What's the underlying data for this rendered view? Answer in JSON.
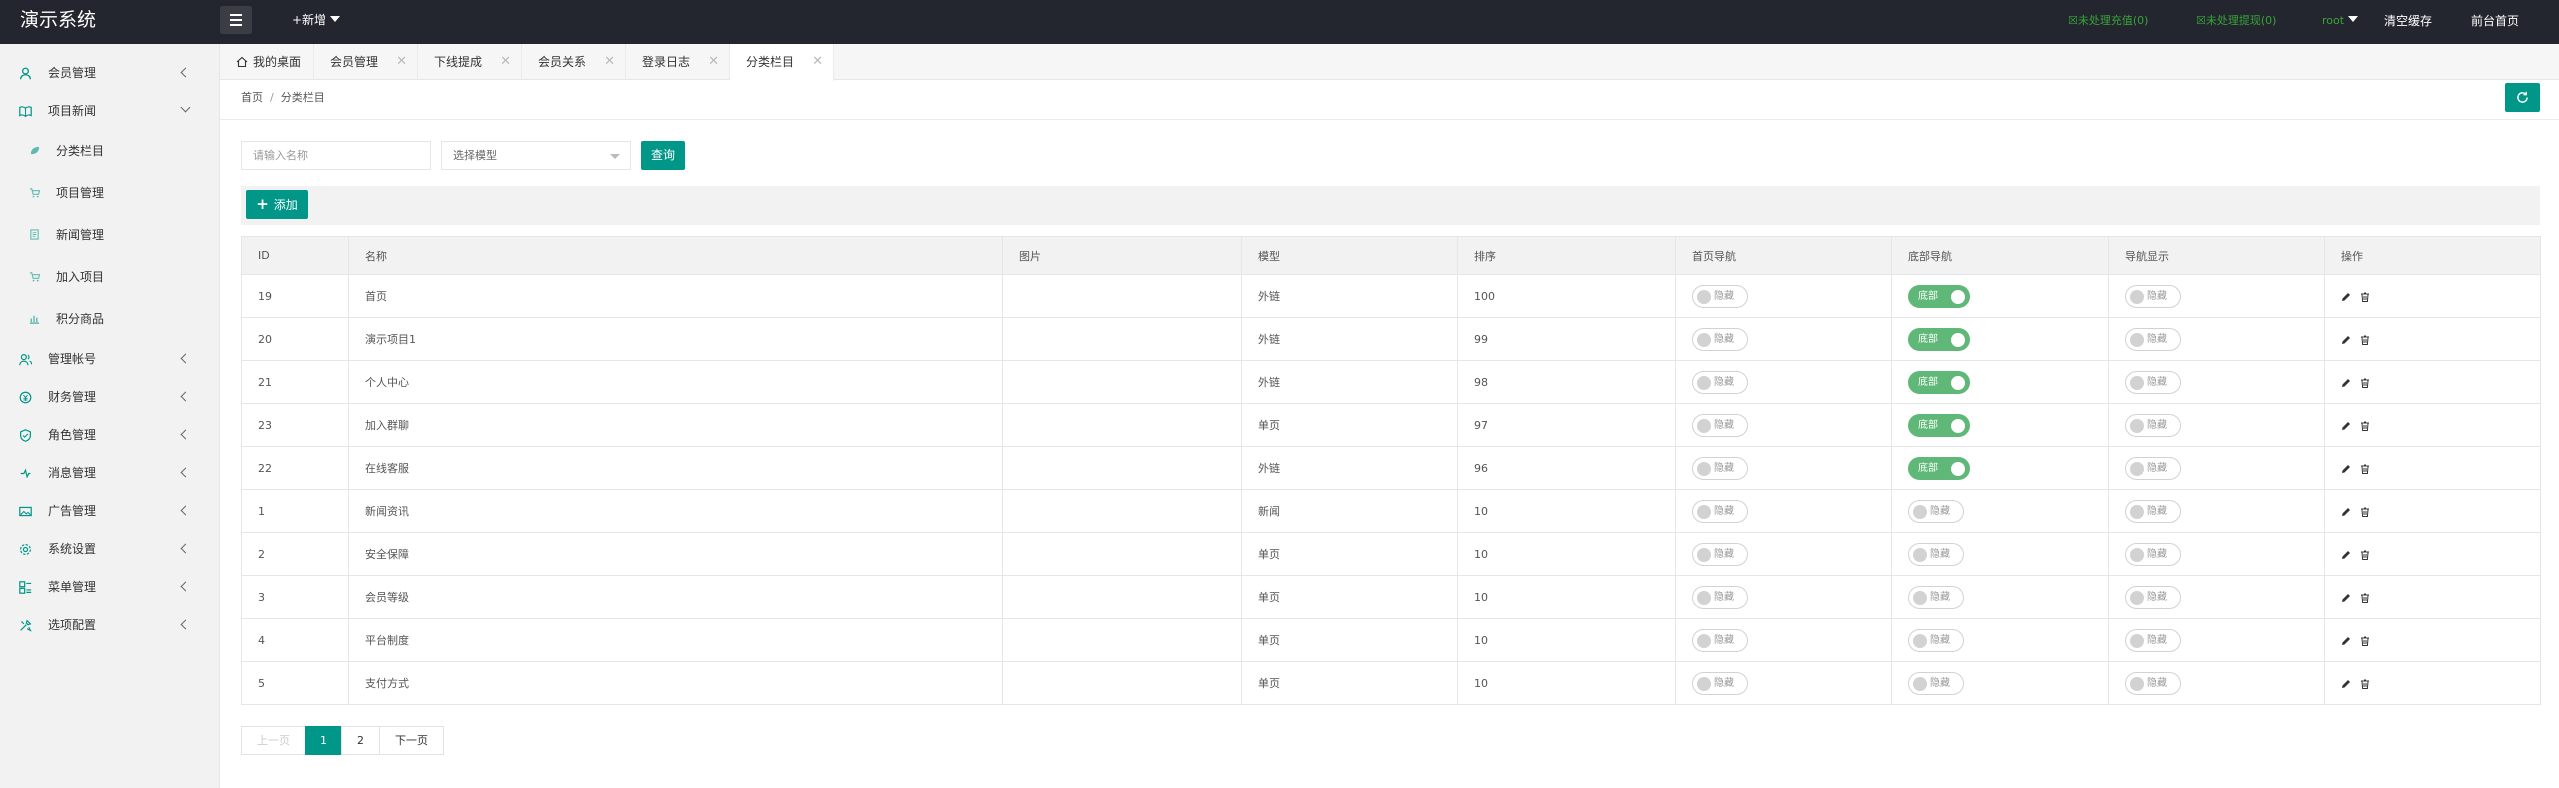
{
  "header": {
    "logo": "演示系统",
    "add_new": "+新增",
    "pending_recharge": "未处理充值(0)",
    "pending_withdraw": "未处理提现(0)",
    "user": "root",
    "clear_cache": "清空缓存",
    "frontend_home": "前台首页",
    "accent_color": "#3aa33a"
  },
  "sidebar": {
    "items": [
      {
        "label": "会员管理",
        "icon": "user-icon"
      },
      {
        "label": "项目新闻",
        "icon": "book-icon",
        "expanded": true,
        "children": [
          {
            "label": "分类栏目",
            "icon": "leaf-icon"
          },
          {
            "label": "项目管理",
            "icon": "cart-icon"
          },
          {
            "label": "新闻管理",
            "icon": "doc-icon"
          },
          {
            "label": "加入项目",
            "icon": "cart-icon"
          },
          {
            "label": "积分商品",
            "icon": "chart-icon"
          }
        ]
      },
      {
        "label": "管理帐号",
        "icon": "user-group-icon"
      },
      {
        "label": "财务管理",
        "icon": "money-icon"
      },
      {
        "label": "角色管理",
        "icon": "shield-icon"
      },
      {
        "label": "消息管理",
        "icon": "message-icon"
      },
      {
        "label": "广告管理",
        "icon": "image-icon"
      },
      {
        "label": "系统设置",
        "icon": "gear-icon"
      },
      {
        "label": "菜单管理",
        "icon": "menu-icon"
      },
      {
        "label": "选项配置",
        "icon": "config-icon"
      }
    ]
  },
  "tabs": [
    {
      "label": "我的桌面",
      "closable": false
    },
    {
      "label": "会员管理",
      "closable": true
    },
    {
      "label": "下线提成",
      "closable": true
    },
    {
      "label": "会员关系",
      "closable": true
    },
    {
      "label": "登录日志",
      "closable": true
    },
    {
      "label": "分类栏目",
      "closable": true,
      "active": true
    }
  ],
  "breadcrumb": {
    "home": "首页",
    "sep": "/",
    "current": "分类栏目"
  },
  "search": {
    "placeholder": "请输入名称",
    "select_placeholder": "选择模型",
    "query_label": "查询"
  },
  "toolbar": {
    "add_label": "添加"
  },
  "table": {
    "columns": [
      "ID",
      "名称",
      "图片",
      "模型",
      "排序",
      "首页导航",
      "底部导航",
      "导航显示",
      "操作"
    ],
    "switch_off_label": "隐藏",
    "switch_on_label": "底部",
    "rows": [
      {
        "id": "19",
        "name": "首页",
        "image": "",
        "model": "外链",
        "sort": "100",
        "home_nav": false,
        "footer_nav": true,
        "nav_show": false
      },
      {
        "id": "20",
        "name": "演示项目1",
        "image": "",
        "model": "外链",
        "sort": "99",
        "home_nav": false,
        "footer_nav": true,
        "nav_show": false
      },
      {
        "id": "21",
        "name": "个人中心",
        "image": "",
        "model": "外链",
        "sort": "98",
        "home_nav": false,
        "footer_nav": true,
        "nav_show": false
      },
      {
        "id": "23",
        "name": "加入群聊",
        "image": "",
        "model": "单页",
        "sort": "97",
        "home_nav": false,
        "footer_nav": true,
        "nav_show": false
      },
      {
        "id": "22",
        "name": "在线客服",
        "image": "",
        "model": "外链",
        "sort": "96",
        "home_nav": false,
        "footer_nav": true,
        "nav_show": false
      },
      {
        "id": "1",
        "name": "新闻资讯",
        "image": "",
        "model": "新闻",
        "sort": "10",
        "home_nav": false,
        "footer_nav": false,
        "nav_show": false
      },
      {
        "id": "2",
        "name": "安全保障",
        "image": "",
        "model": "单页",
        "sort": "10",
        "home_nav": false,
        "footer_nav": false,
        "nav_show": false
      },
      {
        "id": "3",
        "name": "会员等级",
        "image": "",
        "model": "单页",
        "sort": "10",
        "home_nav": false,
        "footer_nav": false,
        "nav_show": false
      },
      {
        "id": "4",
        "name": "平台制度",
        "image": "",
        "model": "单页",
        "sort": "10",
        "home_nav": false,
        "footer_nav": false,
        "nav_show": false
      },
      {
        "id": "5",
        "name": "支付方式",
        "image": "",
        "model": "单页",
        "sort": "10",
        "home_nav": false,
        "footer_nav": false,
        "nav_show": false
      }
    ]
  },
  "pagination": {
    "prev": "上一页",
    "pages": [
      "1",
      "2"
    ],
    "current": "1",
    "next": "下一页"
  }
}
